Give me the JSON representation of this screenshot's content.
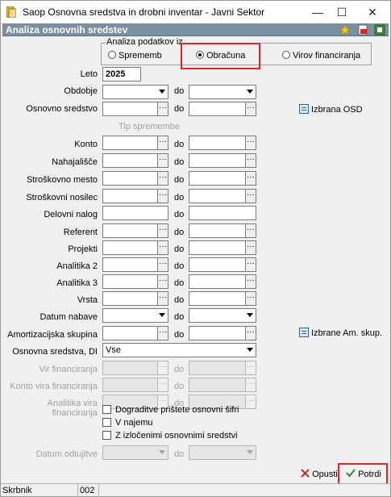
{
  "window": {
    "title": "Saop Osnovna sredstva in drobni inventar  - Javni Sektor",
    "minimize": "—",
    "maximize": "☐",
    "close": "✕"
  },
  "section": {
    "title": "Analiza osnovnih sredstev"
  },
  "analysis_group": {
    "label": "Analiza podatkov iz",
    "options": [
      "Sprememb",
      "Obračuna",
      "Virov financiranja"
    ],
    "selected": "Obračuna"
  },
  "form": {
    "leto_label": "Leto",
    "leto_value": "2025",
    "do_label": "do",
    "tip_sprememb": "Tip spremembe",
    "obdobje": "Obdobje",
    "osnovno_sredstvo": "Osnovno sredstvo",
    "izbrana_osd": "Izbrana OSD",
    "konto": "Konto",
    "nahajalisce": "Nahajališče",
    "stroskovno_mesto": "Stroškovno mesto",
    "stroskovni_nosilec": "Stroškovni nosilec",
    "delovni_nalog": "Delovni nalog",
    "referent": "Referent",
    "projekti": "Projekti",
    "analitika2": "Analitika 2",
    "analitika3": "Analitika 3",
    "vrsta": "Vrsta",
    "datum_nabave": "Datum nabave",
    "amortizacijska_skupina": "Amortizacijska skupina",
    "izbrane_am_skup": "Izbrane Am. skup.",
    "osnovna_sredstva_di": "Osnovna sredstva, DI",
    "osnovna_sredstva_di_value": "Vse",
    "vir_financiranja": "Vir financiranja",
    "konto_vira": "Konto vira financiranja",
    "analitika_vira": "Analitika vira financiranja",
    "datum_odtujitve": "Datum odtujitve",
    "ellipsis": "···"
  },
  "checkboxes": [
    "Dograditve prištete osnovni šifri",
    "V najemu",
    "Z izločenimi osnovnimi sredstvi"
  ],
  "buttons": {
    "cancel": "Opusti",
    "confirm": "Potrdi"
  },
  "status": {
    "user": "Skrbnik",
    "code": "002"
  },
  "colors": {
    "highlight": "#e0212f",
    "section_bar": "#7a8fa0"
  }
}
